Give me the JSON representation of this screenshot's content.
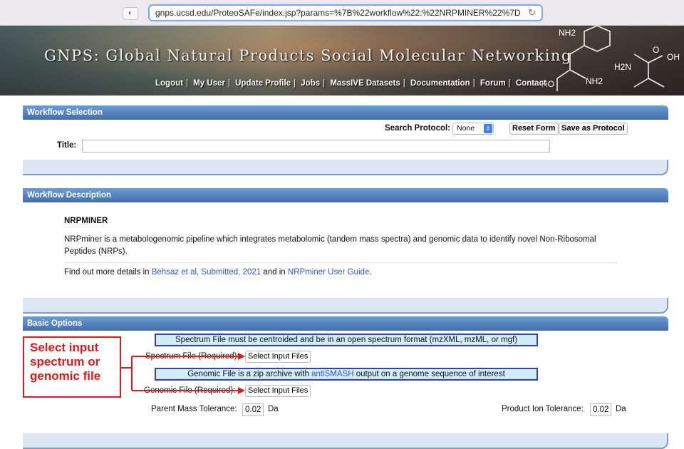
{
  "browser": {
    "url": "gnps.ucsd.edu/ProteoSAFe/index.jsp?params=%7B%22workflow%22:%22NRPMINER%22%7D"
  },
  "banner": {
    "title": "GNPS: Global Natural Products Social Molecular Networking",
    "nav": [
      "Logout",
      "My User",
      "Update Profile",
      "Jobs",
      "MassIVE Datasets",
      "Documentation",
      "Forum",
      "Contact"
    ],
    "molecule_labels": {
      "nh2_top": "NH2",
      "oh": "OH",
      "h2n": "H2N",
      "ho": "HO",
      "nh2_bottom": "NH2",
      "o": "O"
    }
  },
  "workflow_selection": {
    "heading": "Workflow Selection",
    "search_protocol_label": "Search Protocol:",
    "search_protocol_value": "None",
    "reset_label": "Reset Form",
    "save_protocol_label": "Save as Protocol",
    "title_label": "Title:",
    "title_value": ""
  },
  "workflow_description": {
    "heading": "Workflow Description",
    "name": "NRPMINER",
    "description": "NRPminer is a metabologenomic pipeline which integrates metabolomic (tandem mass spectra) and genomic data to identify novel Non-Ribosomal Peptides (NRPs).",
    "more_prefix": "Find out more details in ",
    "more_link1": "Behsaz et al, Submitted, 2021",
    "more_middle": " and in ",
    "more_link2": "NRPminer User Guide",
    "more_suffix": "."
  },
  "basic_options": {
    "heading": "Basic Options",
    "spectrum_info": "Spectrum File must be centroided and be in an open spectrum format (mzXML, mzML, or mgf)",
    "spectrum_label": "Spectrum File (Required):",
    "select_input_label": "Select Input Files",
    "genomic_info_prefix": "Genomic File is a zip archive with ",
    "genomic_info_link": "antiSMASH",
    "genomic_info_suffix": " output on a genome sequence of interest",
    "genomic_label": "Genomic File (Required):",
    "parent_mass_label": "Parent Mass Tolerance:",
    "parent_mass_value": "0.02",
    "product_ion_label": "Product Ion Tolerance:",
    "product_ion_value": "0.02",
    "unit": "Da"
  },
  "annotation": {
    "callout_text": "Select input spectrum or genomic file",
    "color": "#e0191b"
  }
}
